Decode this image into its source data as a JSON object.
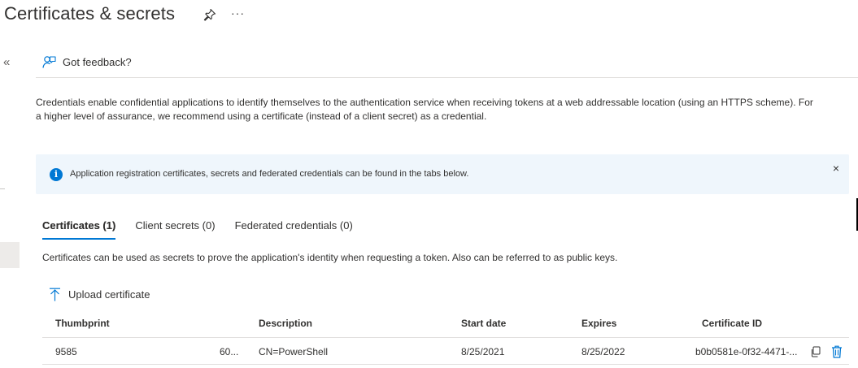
{
  "header": {
    "title": "Certificates & secrets",
    "more_label": "···"
  },
  "sidebar": {
    "collapse_label": "«"
  },
  "toolbar": {
    "feedback_label": "Got feedback?"
  },
  "intro_text": "Credentials enable confidential applications to identify themselves to the authentication service when receiving tokens at a web addressable location (using an HTTPS scheme). For a higher level of assurance, we recommend using a certificate (instead of a client secret) as a credential.",
  "info_banner": {
    "text": "Application registration certificates, secrets and federated credentials can be found in the tabs below.",
    "close_label": "×"
  },
  "tabs": [
    {
      "label": "Certificates (1)",
      "active": true
    },
    {
      "label": "Client secrets (0)",
      "active": false
    },
    {
      "label": "Federated credentials (0)",
      "active": false
    }
  ],
  "certificates_tab": {
    "description": "Certificates can be used as secrets to prove the application's identity when requesting a token. Also can be referred to as public keys.",
    "upload_label": "Upload certificate",
    "columns": [
      "Thumbprint",
      "Description",
      "Start date",
      "Expires",
      "Certificate ID"
    ],
    "rows": [
      {
        "thumbprint_start": "9585",
        "thumbprint_end": "60...",
        "description": "CN=PowerShell",
        "start_date": "8/25/2021",
        "expires": "8/25/2022",
        "certificate_id": "b0b0581e-0f32-4471-..."
      }
    ]
  },
  "colors": {
    "accent": "#0078d4",
    "banner_bg": "#eff6fc",
    "text": "#323130",
    "divider": "#e1dfdd"
  },
  "icons": {
    "pin": "pin-icon",
    "more": "more-icon",
    "collapse": "double-chevron-left-icon",
    "feedback": "feedback-person-icon",
    "info": "info-icon",
    "close": "close-icon",
    "upload": "upload-icon",
    "copy": "copy-icon",
    "delete": "delete-icon"
  }
}
